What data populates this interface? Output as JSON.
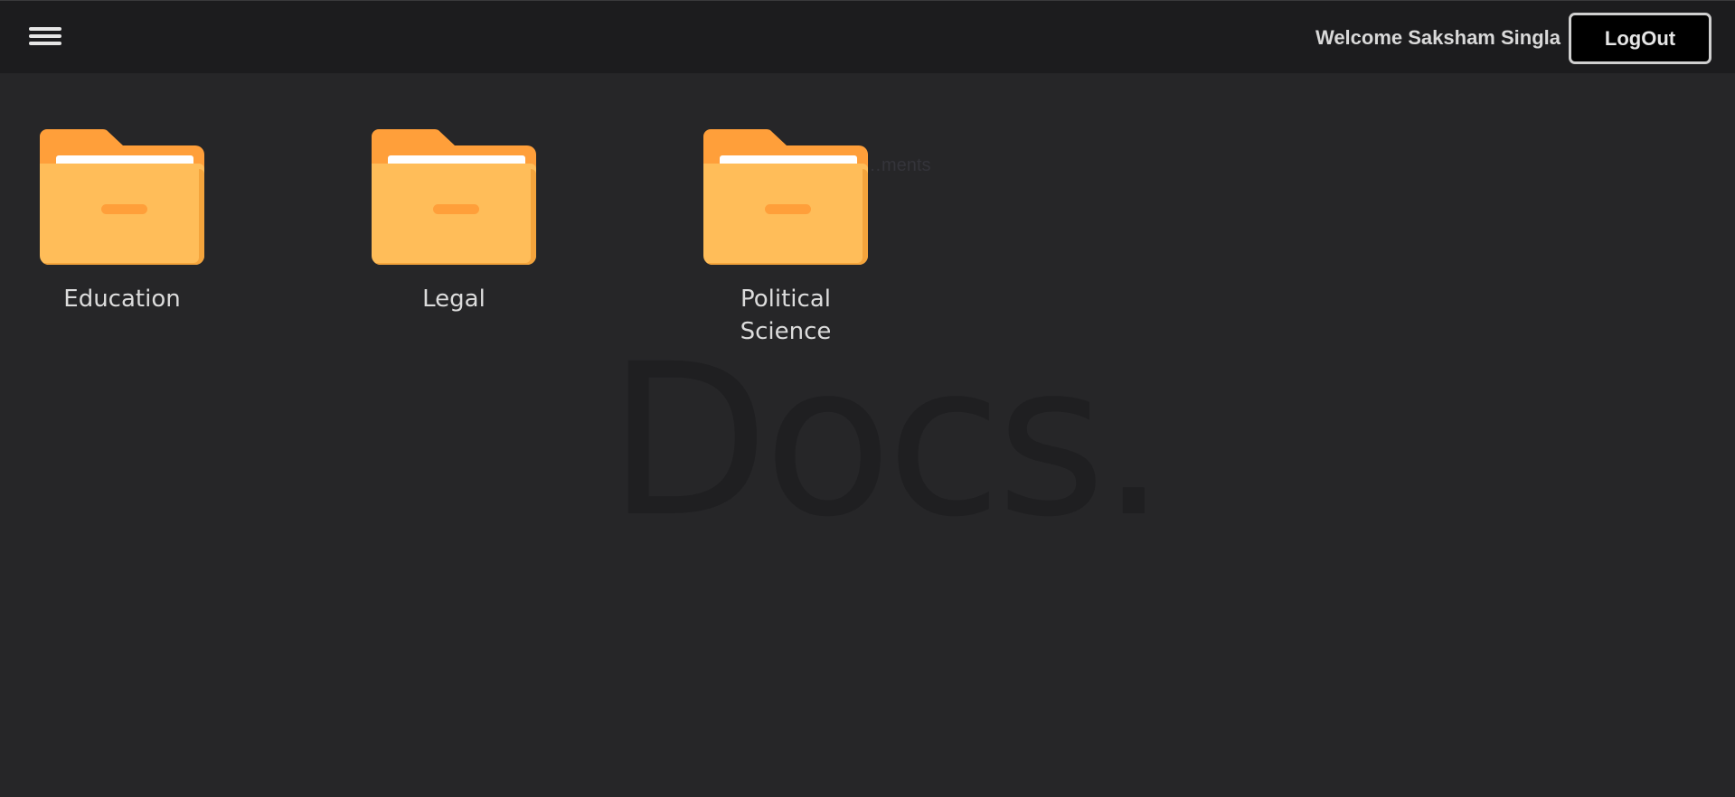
{
  "header": {
    "menu_icon": "hamburger-menu-icon",
    "welcome_text": "Welcome Saksham Singla",
    "logout_label": "LogOut"
  },
  "background": {
    "watermark_text": "Docs.",
    "watermark_subtext": "…ments"
  },
  "folders": [
    {
      "label": "Education",
      "icon": "folder-icon"
    },
    {
      "label": "Legal",
      "icon": "folder-icon"
    },
    {
      "label": "Political Science",
      "icon": "folder-icon"
    }
  ],
  "colors": {
    "background": "#262628",
    "header": "#1c1c1e",
    "folder_front": "#ffbd59",
    "folder_back": "#ff9f3a",
    "folder_paper": "#ffffff"
  }
}
